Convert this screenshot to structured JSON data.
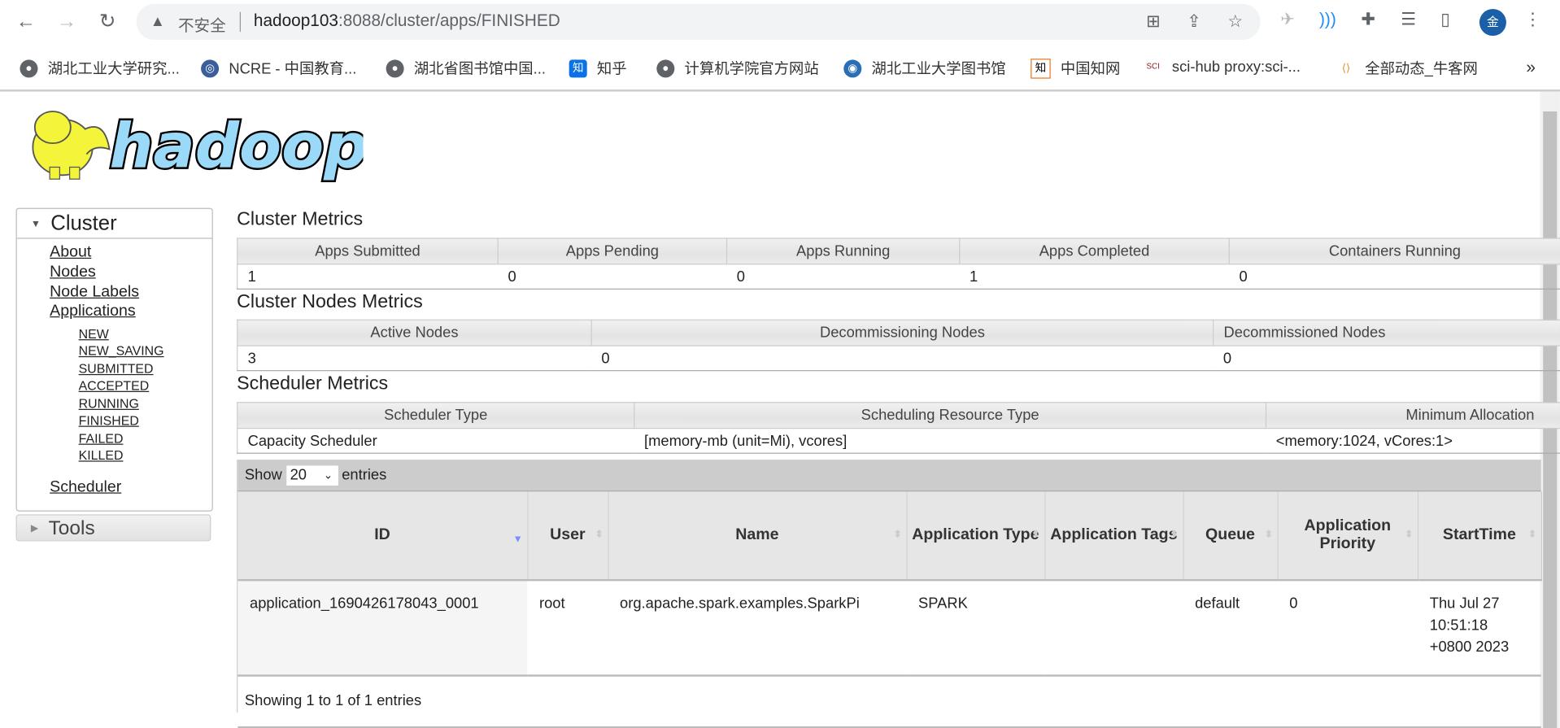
{
  "browser": {
    "security_label": "不安全",
    "url_host": "hadoop103",
    "url_rest": ":8088/cluster/apps/FINISHED",
    "profile_initial": "金",
    "bookmarks": [
      "湖北工业大学研究...",
      "NCRE - 中国教育...",
      "湖北省图书馆中国...",
      "知乎",
      "计算机学院官方网站",
      "湖北工业大学图书馆",
      "中国知网",
      "sci-hub proxy:sci-...",
      "全部动态_牛客网"
    ],
    "more_label": "»"
  },
  "logo_text": "hadoop",
  "sidebar": {
    "cluster_title": "Cluster",
    "links": [
      "About",
      "Nodes",
      "Node Labels",
      "Applications"
    ],
    "app_states": [
      "NEW",
      "NEW_SAVING",
      "SUBMITTED",
      "ACCEPTED",
      "RUNNING",
      "FINISHED",
      "FAILED",
      "KILLED"
    ],
    "scheduler": "Scheduler",
    "tools_title": "Tools"
  },
  "cluster_metrics": {
    "title": "Cluster Metrics",
    "headers": [
      "Apps Submitted",
      "Apps Pending",
      "Apps Running",
      "Apps Completed",
      "Containers Running"
    ],
    "values": [
      "1",
      "0",
      "0",
      "1",
      "0"
    ]
  },
  "nodes_metrics": {
    "title": "Cluster Nodes Metrics",
    "headers": [
      "Active Nodes",
      "Decommissioning Nodes",
      "Decommissioned Nodes"
    ],
    "values": [
      "3",
      "0",
      "0"
    ]
  },
  "scheduler_metrics": {
    "title": "Scheduler Metrics",
    "headers": [
      "Scheduler Type",
      "Scheduling Resource Type",
      "Minimum Allocation"
    ],
    "values": [
      "Capacity Scheduler",
      "[memory-mb (unit=Mi), vcores]",
      "<memory:1024, vCores:1>"
    ]
  },
  "apps": {
    "show_label": "Show",
    "page_size": "20",
    "entries_label": "entries",
    "headers": [
      "ID",
      "User",
      "Name",
      "Application Type",
      "Application Tags",
      "Queue",
      "Application Priority",
      "StartTime"
    ],
    "rows": [
      {
        "id": "application_1690426178043_0001",
        "user": "root",
        "name": "org.apache.spark.examples.SparkPi",
        "type": "SPARK",
        "tags": "",
        "queue": "default",
        "priority": "0",
        "start": "Thu Jul 27 10:51:18 +0800 2023"
      }
    ],
    "footer": "Showing 1 to 1 of 1 entries"
  }
}
